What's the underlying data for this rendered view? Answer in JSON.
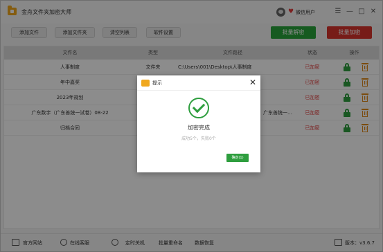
{
  "app": {
    "title": "金舟文件夹加密大师",
    "user_label": "微信用户",
    "heart_glyph": "♥",
    "minimize_glyph": "—",
    "maximize_glyph": "□",
    "menu_glyph": "☰",
    "close_glyph": "✕"
  },
  "toolbar": {
    "add_file": "添加文件",
    "add_folder": "添加文件夹",
    "clear_list": "清空列表",
    "settings": "软件设置",
    "batch_decrypt": "批量解密",
    "batch_encrypt": "批量加密",
    "decrypt_color": "#29a53b",
    "encrypt_color": "#d9332c"
  },
  "table": {
    "headers": {
      "name": "文件名",
      "type": "类型",
      "path": "文件路径",
      "status": "状态",
      "action": "操作"
    },
    "rows": [
      {
        "name": "人事制度",
        "type": "文件夹",
        "path": "C:\\Users\\001\\Desktop\\人事制度",
        "status": "已加密"
      },
      {
        "name": "年中嘉奖",
        "type": "",
        "path": "",
        "status": "已加密"
      },
      {
        "name": "2023年规划",
        "type": "",
        "path": "",
        "status": "已加密"
      },
      {
        "name": "广东数字（广东善统一试卷）08-22",
        "type": "",
        "path": "广东善统一…",
        "status": "已加密"
      },
      {
        "name": "归档合同",
        "type": "",
        "path": "",
        "status": "已加密"
      }
    ]
  },
  "statusbar": {
    "website": "官方网站",
    "support": "在线客服",
    "timer_shutdown": "定时关机",
    "batch_rename": "批量重命名",
    "data_recovery": "数据恢复",
    "version": "版本：v3.6.7"
  },
  "dialog": {
    "title": "提示",
    "close_glyph": "✕",
    "message": "加密完成",
    "summary": "成功5个，失败0个",
    "confirm_label": "确定(1)"
  }
}
